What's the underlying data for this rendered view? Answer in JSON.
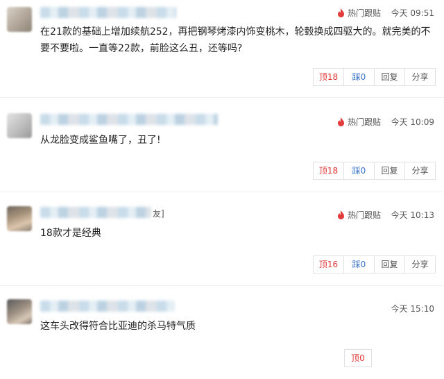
{
  "comments": [
    {
      "username_suffix": "",
      "hot_label": "热门跟贴",
      "time": "今天 09:51",
      "text": "在21款的基础上增加续航252，再把钢琴烤漆内饰变桃木，轮毂换成四驱大的。就完美的不要不要啦。一直等22款，前脸这么丑，还等吗?",
      "up_label": "顶18",
      "down_label": "踩0",
      "reply_label": "回复",
      "share_label": "分享"
    },
    {
      "username_suffix": "",
      "hot_label": "热门跟贴",
      "time": "今天 10:09",
      "text": "从龙脸变成鲨鱼嘴了，丑了!",
      "up_label": "顶18",
      "down_label": "踩0",
      "reply_label": "回复",
      "share_label": "分享"
    },
    {
      "username_suffix": "友]",
      "hot_label": "热门跟贴",
      "time": "今天 10:13",
      "text": "18款才是经典",
      "up_label": "顶16",
      "down_label": "踩0",
      "reply_label": "回复",
      "share_label": "分享"
    },
    {
      "username_suffix": "",
      "time": "今天 15:10",
      "text": "这车头改得符合比亚迪的杀马特气质",
      "up_label": "顶0"
    }
  ],
  "colors": {
    "up": "#e23636",
    "down": "#3a73c9",
    "fire": "#e23b3b"
  }
}
